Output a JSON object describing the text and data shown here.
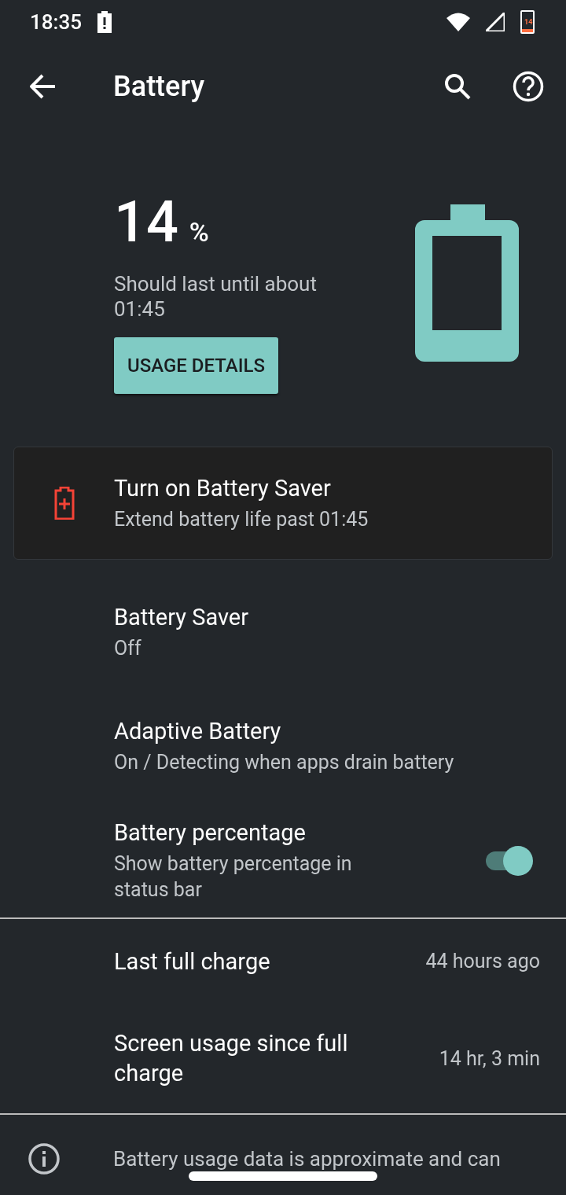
{
  "status_bar": {
    "time": "18:35",
    "battery_text": "14"
  },
  "toolbar": {
    "title": "Battery"
  },
  "summary": {
    "percent": "14",
    "unit": "%",
    "estimate": "Should last until about 01:45",
    "button": "USAGE DETAILS"
  },
  "suggestion": {
    "title": "Turn on Battery Saver",
    "subtitle": "Extend battery life past 01:45"
  },
  "settings": [
    {
      "kind": "text",
      "title": "Battery Saver",
      "summary": "Off"
    },
    {
      "kind": "text",
      "title": "Adaptive Battery",
      "summary": "On / Detecting when apps drain battery"
    },
    {
      "kind": "switch",
      "title": "Battery percentage",
      "summary": "Show battery percentage in status bar",
      "on": true
    }
  ],
  "stats": [
    {
      "label": "Last full charge",
      "value": "44 hours ago"
    },
    {
      "label": "Screen usage since full charge",
      "value": "14 hr, 3 min"
    }
  ],
  "footer": {
    "text": "Battery usage data is approximate and can"
  }
}
